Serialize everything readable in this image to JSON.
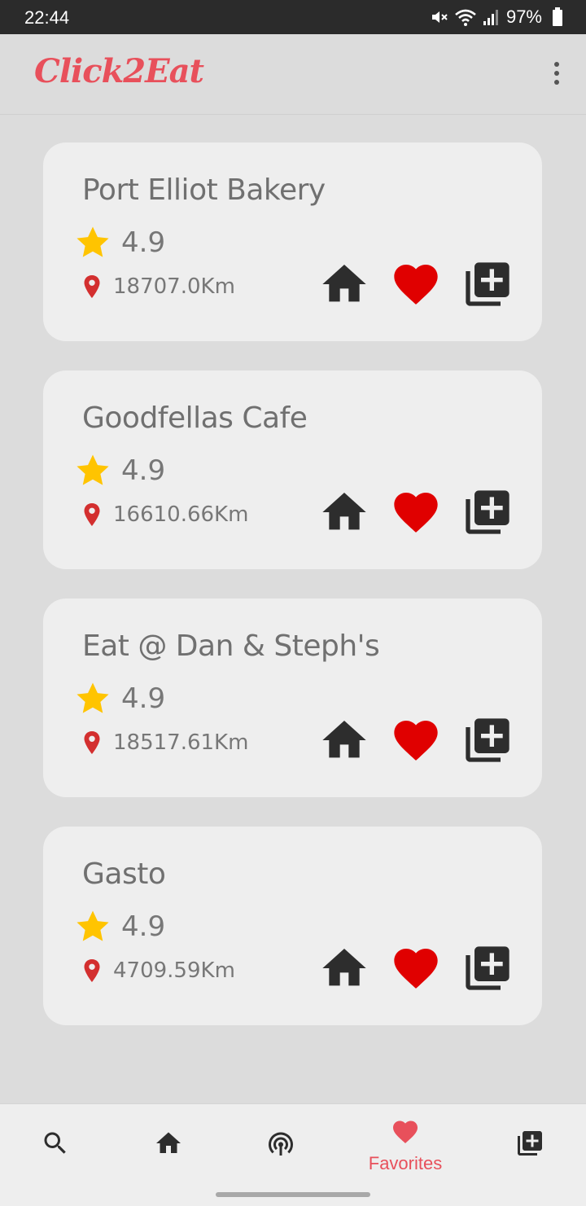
{
  "status_bar": {
    "time": "22:44",
    "battery": "97%"
  },
  "app": {
    "title": "Click2Eat",
    "brand_color": "#e8505b"
  },
  "icons": {
    "star_color": "#ffc400",
    "pin_color": "#d32f2f",
    "heart_color": "#e00000",
    "action_color": "#2d2d2d",
    "card_actions": [
      "home-icon",
      "heart-icon",
      "add-to-collection-icon"
    ]
  },
  "restaurants": [
    {
      "name": "Port Elliot Bakery",
      "rating": "4.9",
      "distance": "18707.0Km"
    },
    {
      "name": "Goodfellas Cafe",
      "rating": "4.9",
      "distance": "16610.66Km"
    },
    {
      "name": "Eat @ Dan & Steph's",
      "rating": "4.9",
      "distance": "18517.61Km"
    },
    {
      "name": "Gasto",
      "rating": "4.9",
      "distance": "4709.59Km"
    }
  ],
  "bottom_nav": {
    "items": [
      {
        "icon": "search-icon"
      },
      {
        "icon": "home-icon"
      },
      {
        "icon": "broadcast-icon"
      },
      {
        "icon": "heart-icon",
        "label": "Favorites",
        "active": true
      },
      {
        "icon": "add-to-collection-icon"
      }
    ],
    "active_color": "#e8505b",
    "inactive_color": "#2d2d2d"
  }
}
